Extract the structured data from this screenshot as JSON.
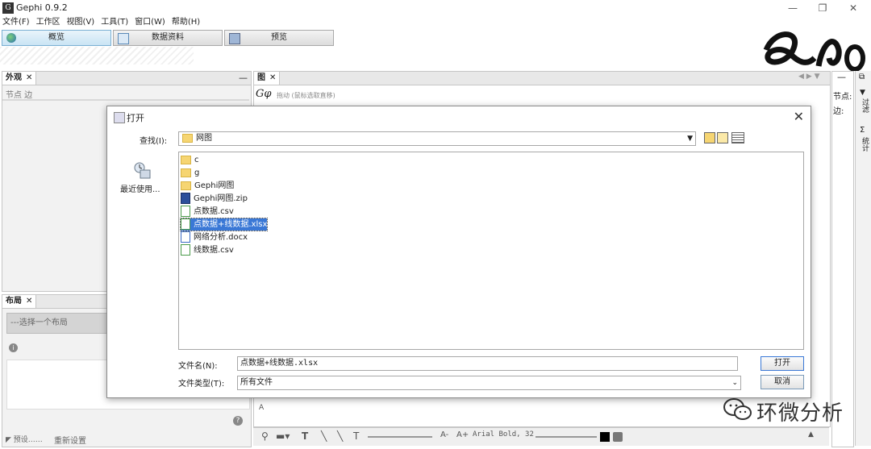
{
  "window": {
    "title": "Gephi 0.9.2",
    "min": "—",
    "max": "❐",
    "close": "✕"
  },
  "menu": [
    "文件(F)",
    "工作区",
    "视图(V)",
    "工具(T)",
    "窗口(W)",
    "帮助(H)"
  ],
  "workspace_tabs": [
    "概览",
    "数据资料",
    "预览"
  ],
  "left_panel": {
    "tab": "外观",
    "close": "✕",
    "min": "—",
    "subtabs": "节点 边"
  },
  "layout_panel": {
    "tab": "布局",
    "close": "✕",
    "select_placeholder": "---选择一个布局",
    "info": "i",
    "help": "?",
    "presets": "预设……",
    "reset": "重新设置"
  },
  "graph_panel": {
    "tab": "图",
    "close": "✕",
    "drag_hint": "拖动 (鼠标选取直移)"
  },
  "right_panel": {
    "nodes_label": "节点:",
    "edges_label": "边:",
    "filter_label": "过滤",
    "stats_label": "统计",
    "sigma": "Σ",
    "filter_icon": "▼"
  },
  "dialog": {
    "title": "打开",
    "close": "✕",
    "lookin_label": "查找(I):",
    "lookin_value": "网图",
    "recent_label": "最近使用...",
    "files": [
      {
        "name": "c",
        "type": "folder"
      },
      {
        "name": "g",
        "type": "folder"
      },
      {
        "name": "Gephi网图",
        "type": "folder"
      },
      {
        "name": "Gephi网图.zip",
        "type": "zip"
      },
      {
        "name": "点数据.csv",
        "type": "csv"
      },
      {
        "name": "点数据+线数据.xlsx",
        "type": "xlsx",
        "selected": true
      },
      {
        "name": "网络分析.docx",
        "type": "docx"
      },
      {
        "name": "线数据.csv",
        "type": "csv"
      }
    ],
    "filename_label": "文件名(N):",
    "filename_value": "点数据+线数据.xlsx",
    "filetype_label": "文件类型(T):",
    "filetype_value": "所有文件",
    "open_button": "打开",
    "cancel_button": "取消"
  },
  "bottom_toolbar": {
    "font_label": "Arial Bold, 32",
    "font_smaller": "A-",
    "font_larger": "A+",
    "text_tool": "T",
    "small_a": "A"
  },
  "watermark": {
    "text": "环微分析"
  },
  "colors": {
    "selection": "#3a78d6",
    "folder": "#f6d572",
    "dialog_border": "#8a8a8a"
  }
}
